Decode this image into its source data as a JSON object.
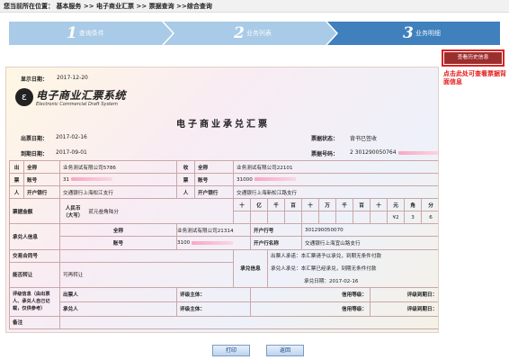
{
  "breadcrumb": {
    "prefix": "您当前所在位置：",
    "items": [
      "基本服务",
      ">>",
      "电子商业汇票",
      ">>",
      "票据查询",
      ">>综合查询"
    ]
  },
  "steps": [
    {
      "num": "1",
      "label": "查询条件"
    },
    {
      "num": "2",
      "label": "业务列表"
    },
    {
      "num": "3",
      "label": "业务明细"
    }
  ],
  "history_button": "查看历史信息",
  "annotation": "点击此处可查看票据背面信息",
  "bill": {
    "display_date_label": "显示日期：",
    "display_date": "2017-12-20",
    "logo_cn": "电子商业汇票系统",
    "logo_en": "Electronic Commercial Draft System",
    "title": "电子商业承兑汇票",
    "issue_date_label": "出票日期：",
    "issue_date": "2017-02-16",
    "due_date_label": "到期日期：",
    "due_date": "2017-09-01",
    "status_label": "票据状态：",
    "status": "背书已签收",
    "number_label": "票据号码：",
    "number": "2 301290050764",
    "drawer": {
      "side": [
        "出",
        "票",
        "人"
      ],
      "name_label": "全称",
      "name": "业务测试有限公司5786",
      "account_label": "账号",
      "account": "31",
      "bank_label": "开户银行",
      "bank": "交通银行上海松江支行"
    },
    "payee": {
      "side": [
        "收",
        "票",
        "人"
      ],
      "name_label": "全称",
      "name": "业务测试有限公司22101",
      "account_label": "账号",
      "account": "31000",
      "bank_label": "开户银行",
      "bank": "交通银行上海新松江路支行"
    },
    "amount": {
      "label": "票据金额",
      "currency": "人民币",
      "currency2": "（大写）",
      "words": "贰元叁角陆分",
      "units": [
        "十",
        "亿",
        "千",
        "百",
        "十",
        "万",
        "千",
        "百",
        "十",
        "元",
        "角",
        "分"
      ],
      "digits": [
        "",
        "",
        "",
        "",
        "",
        "",
        "",
        "",
        "",
        "¥2",
        "3",
        "6"
      ]
    },
    "acceptor": {
      "label": "承兑人信息",
      "name_label": "全称",
      "name": "业务测试有限公司21314",
      "account_label": "账号",
      "account": "3100",
      "bankno_label": "开户行号",
      "bankno": "301290050070",
      "bankname_label": "开户行名称",
      "bankname": "交通银行上海宜山路支行"
    },
    "contract": {
      "label": "交易合同号"
    },
    "transfer": {
      "label": "能否转让",
      "value": "可再转让"
    },
    "accept_info": {
      "label": "承兑信息",
      "drawer_promise_label": "出票人承诺：",
      "drawer_promise": "本汇票请予以承兑，到期无条件付款",
      "acceptor_promise_label": "承兑人承兑：",
      "acceptor_promise": "本汇票已经承兑，到期无条件付款",
      "accept_date_label": "承兑日期：",
      "accept_date": "2017-02-16"
    },
    "rating": {
      "label": "评级信息（由出票人、承兑人自己记载，仅供参考）",
      "rows": [
        {
          "who": "出票人",
          "subject": "评级主体：",
          "grade": "信用等级：",
          "expire": "评级到期日："
        },
        {
          "who": "承兑人",
          "subject": "评级主体：",
          "grade": "信用等级：",
          "expire": "评级到期日："
        }
      ]
    },
    "remark": {
      "label": "备注"
    }
  },
  "buttons": {
    "print": "打印",
    "back": "返回"
  },
  "colors": {
    "step_inactive": "#a9cbe7",
    "step_active": "#3f80bd",
    "hist_btn": "#9d2e2e",
    "annotation": "#e31818",
    "mask": "#f7a7c4"
  }
}
